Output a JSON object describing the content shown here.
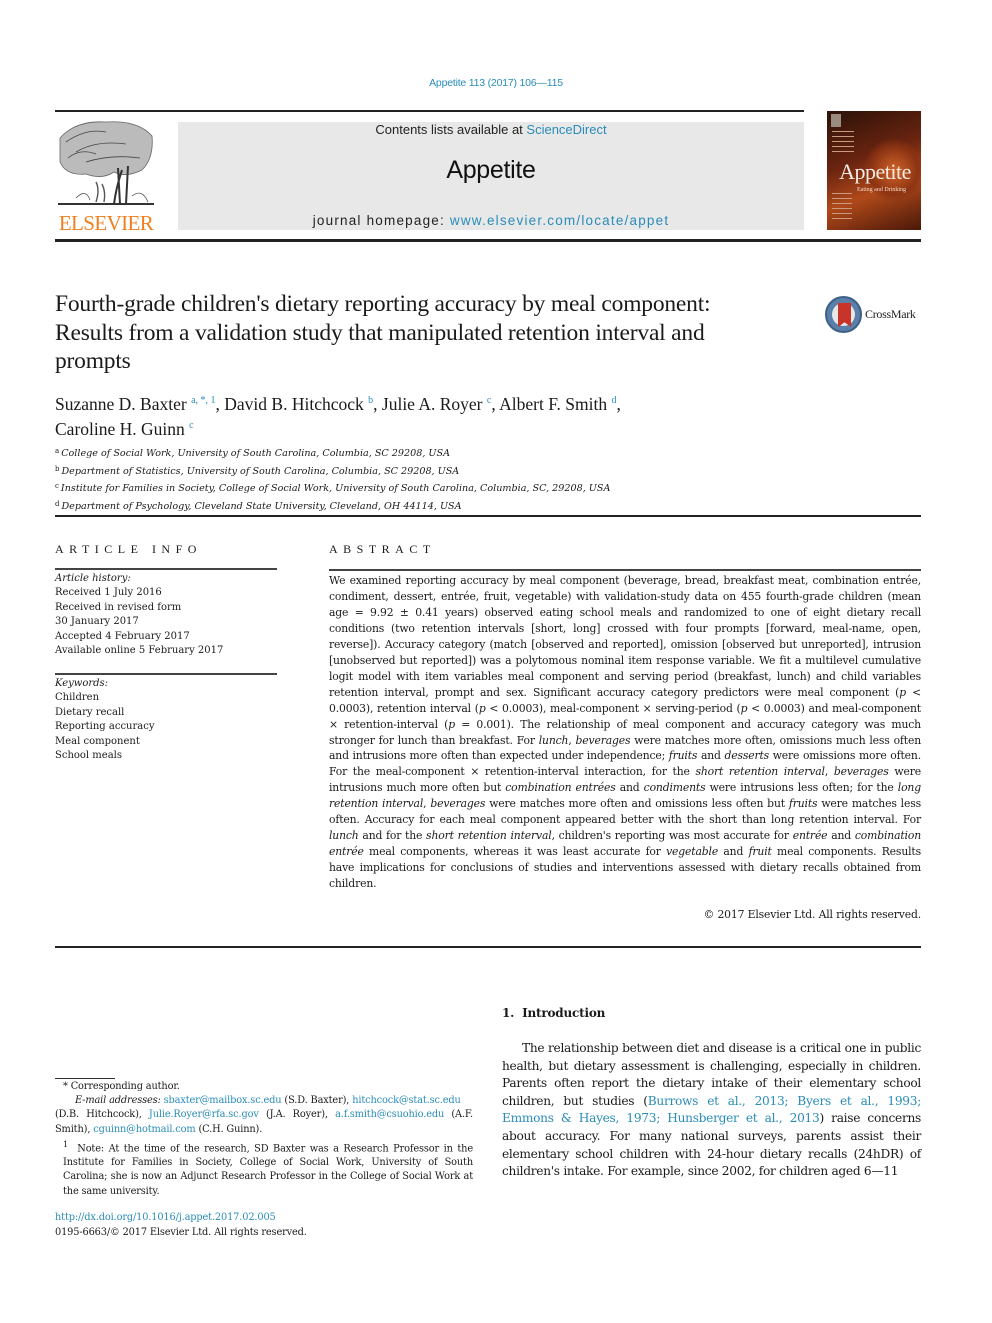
{
  "header": {
    "citation": "Appetite 113 (2017) 106—115",
    "contents_prefix": "Contents lists available at ",
    "contents_link": "ScienceDirect",
    "journal_name": "Appetite",
    "homepage_prefix": "journal homepage: ",
    "homepage_link": "www.elsevier.com/locate/appet",
    "publisher_logo_text": "ELSEVIER",
    "cover_title": "Appetite",
    "cover_subtitle": "Eating and Drinking",
    "colors": {
      "link": "#2a8cb8",
      "elsevier_orange": "#f07f1f",
      "masthead_bg": "#e8e8e8"
    }
  },
  "crossmark": {
    "label": "CrossMark"
  },
  "article": {
    "title": "Fourth-grade children's dietary reporting accuracy by meal component: Results from a validation study that manipulated retention interval and prompts",
    "authors": [
      {
        "name": "Suzanne D. Baxter",
        "marks": "a, *, 1",
        "sep": ", "
      },
      {
        "name": "David B. Hitchcock",
        "marks": "b",
        "sep": ", "
      },
      {
        "name": "Julie A. Royer",
        "marks": "c",
        "sep": ", "
      },
      {
        "name": "Albert F. Smith",
        "marks": "d",
        "sep": ","
      },
      {
        "name": "Caroline H. Guinn",
        "marks": "c",
        "sep": ""
      }
    ],
    "affiliations": [
      {
        "mark": "a",
        "text": "College of Social Work, University of South Carolina, Columbia, SC 29208, USA"
      },
      {
        "mark": "b",
        "text": "Department of Statistics, University of South Carolina, Columbia, SC 29208, USA"
      },
      {
        "mark": "c",
        "text": "Institute for Families in Society, College of Social Work, University of South Carolina, Columbia, SC, 29208, USA"
      },
      {
        "mark": "d",
        "text": "Department of Psychology, Cleveland State University, Cleveland, OH 44114, USA"
      }
    ]
  },
  "article_info": {
    "heading": "ARTICLE INFO",
    "history_heading": "Article history:",
    "history": [
      "Received 1 July 2016",
      "Received in revised form",
      "30 January 2017",
      "Accepted 4 February 2017",
      "Available online 5 February 2017"
    ],
    "keywords_heading": "Keywords:",
    "keywords": [
      "Children",
      "Dietary recall",
      "Reporting accuracy",
      "Meal component",
      "School meals"
    ]
  },
  "abstract": {
    "heading": "ABSTRACT",
    "segments": [
      {
        "t": "We examined reporting accuracy by meal component (beverage, bread, breakfast meat, combination entrée, condiment, dessert, entrée, fruit, vegetable) with validation-study data on 455 fourth-grade children (mean age = 9.92 ± 0.41 years) observed eating school meals and randomized to one of eight dietary recall conditions (two retention intervals [short, long] crossed with four prompts [forward, meal-name, open, reverse]). Accuracy category (match [observed and reported], omission [observed but unreported], intrusion [unobserved but reported]) was a polytomous nominal item response variable. We fit a multilevel cumulative logit model with item variables meal component and serving period (breakfast, lunch) and child variables retention interval, prompt and sex. Significant accuracy category predictors were meal component (",
        "i": false
      },
      {
        "t": "p",
        "i": true
      },
      {
        "t": " < 0.0003), retention interval (",
        "i": false
      },
      {
        "t": "p",
        "i": true
      },
      {
        "t": " < 0.0003), meal-component × serving-period (",
        "i": false
      },
      {
        "t": "p",
        "i": true
      },
      {
        "t": " < 0.0003) and meal-component × retention-interval (",
        "i": false
      },
      {
        "t": "p",
        "i": true
      },
      {
        "t": " = 0.001). The relationship of meal component and accuracy category was much stronger for lunch than breakfast. For ",
        "i": false
      },
      {
        "t": "lunch",
        "i": true
      },
      {
        "t": ", ",
        "i": false
      },
      {
        "t": "beverages",
        "i": true
      },
      {
        "t": " were matches more often, omissions much less often and intrusions more often than expected under independence; ",
        "i": false
      },
      {
        "t": "fruits",
        "i": true
      },
      {
        "t": " and ",
        "i": false
      },
      {
        "t": "desserts",
        "i": true
      },
      {
        "t": " were omissions more often. For the meal-component × retention-interval interaction, for the ",
        "i": false
      },
      {
        "t": "short retention interval",
        "i": true
      },
      {
        "t": ", ",
        "i": false
      },
      {
        "t": "beverages",
        "i": true
      },
      {
        "t": " were intrusions much more often but ",
        "i": false
      },
      {
        "t": "combination entrées",
        "i": true
      },
      {
        "t": " and ",
        "i": false
      },
      {
        "t": "condiments",
        "i": true
      },
      {
        "t": " were intrusions less often; for the ",
        "i": false
      },
      {
        "t": "long retention interval",
        "i": true
      },
      {
        "t": ", ",
        "i": false
      },
      {
        "t": "beverages",
        "i": true
      },
      {
        "t": " were matches more often and omissions less often but ",
        "i": false
      },
      {
        "t": "fruits",
        "i": true
      },
      {
        "t": " were matches less often. Accuracy for each meal component appeared better with the short than long retention interval. For ",
        "i": false
      },
      {
        "t": "lunch",
        "i": true
      },
      {
        "t": " and for the ",
        "i": false
      },
      {
        "t": "short retention interval",
        "i": true
      },
      {
        "t": ", children's reporting was most accurate for ",
        "i": false
      },
      {
        "t": "entrée",
        "i": true
      },
      {
        "t": " and ",
        "i": false
      },
      {
        "t": "combination entrée",
        "i": true
      },
      {
        "t": " meal components, whereas it was least accurate for ",
        "i": false
      },
      {
        "t": "vegetable",
        "i": true
      },
      {
        "t": " and ",
        "i": false
      },
      {
        "t": "fruit",
        "i": true
      },
      {
        "t": " meal components. Results have implications for conclusions of studies and interventions assessed with dietary recalls obtained from children.",
        "i": false
      }
    ],
    "copyright": "© 2017 Elsevier Ltd. All rights reserved."
  },
  "footnotes": {
    "corresponding": "* Corresponding author.",
    "email_label": "E-mail addresses:",
    "emails": [
      {
        "address": "sbaxter@mailbox.sc.edu",
        "who": "(S.D. Baxter)"
      },
      {
        "address": "hitchcock@stat.sc.edu",
        "who": "(D.B. Hitchcock)"
      },
      {
        "address": "Julie.Royer@rfa.sc.gov",
        "who": "(J.A. Royer)"
      },
      {
        "address": "a.f.smith@csuohio.edu",
        "who": "(A.F. Smith)"
      },
      {
        "address": "cguinn@hotmail.com",
        "who": "(C.H. Guinn)."
      }
    ],
    "note_mark": "1",
    "note": "Note: At the time of the research, SD Baxter was a Research Professor in the Institute for Families in Society, College of Social Work, University of South Carolina; she is now an Adjunct Research Professor in the College of Social Work at the same university."
  },
  "doi": {
    "link": "http://dx.doi.org/10.1016/j.appet.2017.02.005",
    "issn_line": "0195-6663/© 2017 Elsevier Ltd. All rights reserved."
  },
  "introduction": {
    "heading": "1.  Introduction",
    "segments": [
      {
        "t": "The relationship between diet and disease is a critical one in public health, but dietary assessment is challenging, especially in children. Parents often report the dietary intake of their elementary school children, but studies (",
        "link": false
      },
      {
        "t": "Burrows et al., 2013; Byers et al., 1993; Emmons & Hayes, 1973; Hunsberger et al., 2013",
        "link": true
      },
      {
        "t": ") raise concerns about accuracy. For many national surveys, parents assist their elementary school children with 24-hour dietary recalls (24hDR) of children's intake. For example, since 2002, for children aged 6—11",
        "link": false
      }
    ]
  }
}
